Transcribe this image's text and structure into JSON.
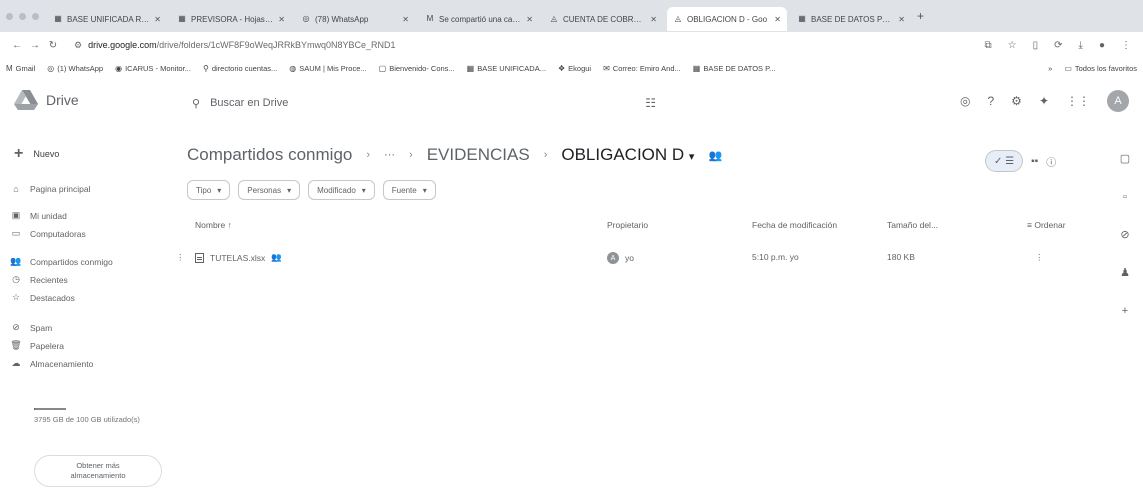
{
  "browser": {
    "tabs": [
      {
        "icon": "spreadsheet-icon",
        "glyph": "▦",
        "title": "BASE UNIFICADA REGA"
      },
      {
        "icon": "spreadsheet-icon",
        "glyph": "▦",
        "title": "PREVISORA - Hojas de"
      },
      {
        "icon": "whatsapp-icon",
        "glyph": "◎",
        "title": "(78) WhatsApp"
      },
      {
        "icon": "gmail-icon",
        "glyph": "M",
        "title": "Se compartió una carpe"
      },
      {
        "icon": "drive-icon",
        "glyph": "◬",
        "title": "CUENTA DE COBRO 7"
      },
      {
        "icon": "drive-icon",
        "glyph": "◬",
        "title": "OBLIGACION D - Goo"
      },
      {
        "icon": "spreadsheet-icon",
        "glyph": "▦",
        "title": "BASE DE DATOS PERS"
      }
    ],
    "url_host": "drive.google.com",
    "url_path": "/drive/folders/1cWF8F9oWeqJRRkBYmwq0N8YBCe_RND1",
    "bookmarks": [
      {
        "icon": "gmail-icon",
        "glyph": "M",
        "label": "Gmail"
      },
      {
        "icon": "whatsapp-icon",
        "glyph": "◎",
        "label": "(1) WhatsApp"
      },
      {
        "icon": "icarus-icon",
        "glyph": "◉",
        "label": "ICARUS - Monitor..."
      },
      {
        "icon": "page-icon",
        "glyph": "⚲",
        "label": "directorio cuentas..."
      },
      {
        "icon": "saum-icon",
        "glyph": "◍",
        "label": "SAUM | Mis Proce..."
      },
      {
        "icon": "page-icon",
        "glyph": "▢",
        "label": "Bienvenido- Cons..."
      },
      {
        "icon": "spreadsheet-icon",
        "glyph": "▦",
        "label": "BASE UNIFICADA..."
      },
      {
        "icon": "ekogui-icon",
        "glyph": "❖",
        "label": "Ekogui"
      },
      {
        "icon": "mail-icon",
        "glyph": "✉",
        "label": "Correo: Emiro And..."
      },
      {
        "icon": "spreadsheet-icon",
        "glyph": "▦",
        "label": "BASE DE DATOS P..."
      }
    ],
    "bookmarks_all": "Todos los favoritos"
  },
  "drive": {
    "app_name": "Drive",
    "search_placeholder": "Buscar en Drive",
    "avatar_letter": "A",
    "new_label": "Nuevo",
    "nav": [
      {
        "icon": "home-icon",
        "glyph": "⌂",
        "label": "Pagina principal"
      },
      {
        "icon": "my-drive-icon",
        "glyph": "▣",
        "label": "Mi unidad"
      },
      {
        "icon": "computers-icon",
        "glyph": "▭",
        "label": "Computadoras"
      },
      {
        "icon": "shared-icon",
        "glyph": "👥",
        "label": "Compartidos conmigo"
      },
      {
        "icon": "recent-icon",
        "glyph": "◷",
        "label": "Recientes"
      },
      {
        "icon": "star-icon",
        "glyph": "☆",
        "label": "Destacados"
      },
      {
        "icon": "spam-icon",
        "glyph": "⊘",
        "label": "Spam"
      },
      {
        "icon": "trash-icon",
        "glyph": "🗑",
        "label": "Papelera"
      },
      {
        "icon": "storage-icon",
        "glyph": "☁",
        "label": "Almacenamiento"
      }
    ],
    "storage_used": 0.033,
    "storage_text": "3795 GB de 100 GB utilizado(s)",
    "get_storage_label": "Obtener más almacenamiento",
    "breadcrumb": {
      "root": "Compartidos conmigo",
      "ellipsis": "···",
      "parent": "EVIDENCIAS",
      "current": "OBLIGACION D"
    },
    "filters": [
      "Tipo",
      "Personas",
      "Modificado",
      "Fuente"
    ],
    "columns": {
      "name": "Nombre",
      "owner": "Propietario",
      "modified": "Fecha de modificación",
      "size": "Tamaño del...",
      "sort": "Ordenar"
    },
    "files": [
      {
        "name": "TUTELAS.xlsx",
        "owner_initial": "A",
        "owner": "yo",
        "modified": "5:10 p.m. yo",
        "size": "180 KB"
      }
    ]
  }
}
